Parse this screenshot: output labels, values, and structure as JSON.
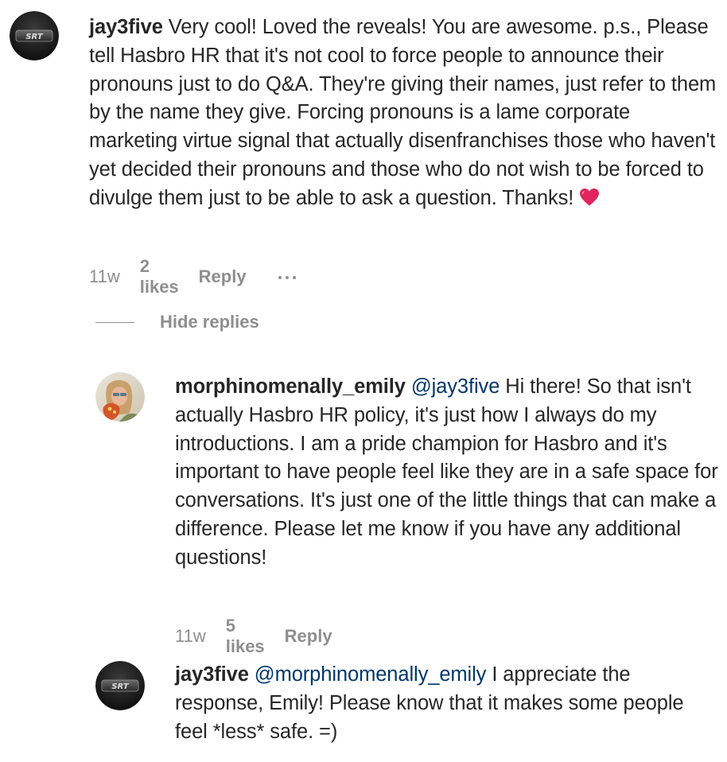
{
  "comments": [
    {
      "username": "jay3five",
      "avatar": "srt-badge-avatar",
      "text": " Very cool! Loved the reveals! You are awesome. p.s., Please tell Hasbro HR that it's not cool to force people to announce their pronouns just to do Q&A. They're giving their names, just refer to them by the name they give. Forcing pronouns is a lame corporate marketing virtue signal that actually disenfranchises those who haven't yet decided their pronouns and those who do not wish to be forced to divulge them just to be able to ask a question. Thanks! ",
      "emoji": "red-heart-icon",
      "time": "11w",
      "likes": "2 likes",
      "reply": "Reply",
      "avatar_badge_text": "SRT"
    }
  ],
  "hide_replies": "Hide replies",
  "replies": [
    {
      "username": "morphinomenally_emily",
      "mention": "@jay3five",
      "text": " Hi there! So that isn't actually Hasbro HR policy, it's just how I always do my introductions. I am a pride champion for Hasbro and it's important to have people feel like they are in a safe space for conversations. It's just one of the little things that can make a difference. Please let me know if you have any additional questions!",
      "time": "11w",
      "likes": "5 likes",
      "reply": "Reply"
    },
    {
      "username": "jay3five",
      "mention": "@morphinomenally_emily",
      "text": " I appreciate the response, Emily! Please know that it makes some people feel *less* safe. =)",
      "avatar_badge_text": "SRT"
    }
  ],
  "colors": {
    "text": "#262626",
    "secondary": "#8e8e8e",
    "mention": "#00376b",
    "heart": "#e0245e"
  }
}
